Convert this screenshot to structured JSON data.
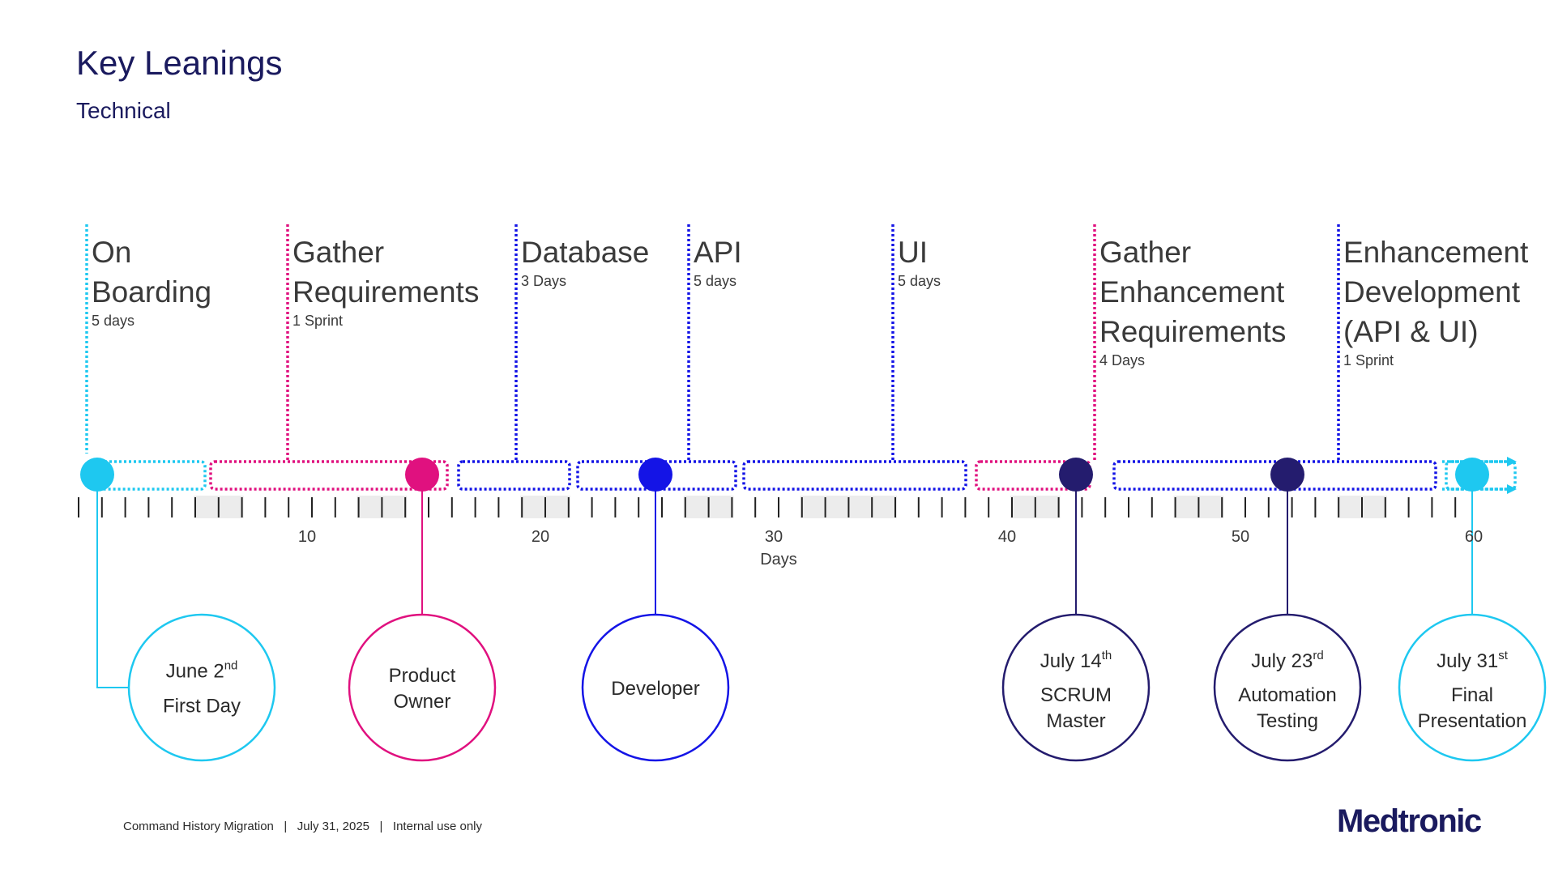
{
  "title": "Key Leanings",
  "subtitle": "Technical",
  "axis": {
    "label": "Days",
    "tick_labels": [
      "10",
      "20",
      "30",
      "40",
      "50",
      "60"
    ]
  },
  "colors": {
    "cyan": "#1ec8f0",
    "magenta": "#e0117f",
    "blue": "#1414e6",
    "navy": "#241c6e",
    "dark_navy": "#2a2072"
  },
  "phases": [
    {
      "title_lines": [
        "On",
        "Boarding"
      ],
      "duration": "5 days",
      "color": "#1ec8f0"
    },
    {
      "title_lines": [
        "Gather",
        "Requirements"
      ],
      "duration": "1 Sprint",
      "color": "#e0117f"
    },
    {
      "title_lines": [
        "Database"
      ],
      "duration": "3 Days",
      "color": "#1414e6"
    },
    {
      "title_lines": [
        "API"
      ],
      "duration": "5 days",
      "color": "#1414e6"
    },
    {
      "title_lines": [
        "UI"
      ],
      "duration": "5 days",
      "color": "#1414e6"
    },
    {
      "title_lines": [
        "Gather",
        "Enhancement",
        "Requirements"
      ],
      "duration": "4 Days",
      "color": "#e0117f"
    },
    {
      "title_lines": [
        "Enhancement",
        "Development",
        "(API & UI)"
      ],
      "duration": "1 Sprint",
      "color": "#1414e6"
    }
  ],
  "milestones": [
    {
      "lines": [
        "June 2|nd",
        "First Day"
      ],
      "color": "#1ec8f0"
    },
    {
      "lines": [
        "Product",
        "Owner"
      ],
      "color": "#e0117f"
    },
    {
      "lines": [
        "Developer"
      ],
      "color": "#1414e6"
    },
    {
      "lines": [
        "July 14|th",
        "SCRUM",
        "Master"
      ],
      "color": "#241c6e"
    },
    {
      "lines": [
        "July 23|rd",
        "Automation",
        "Testing"
      ],
      "color": "#241c6e"
    },
    {
      "lines": [
        "July 31|st",
        "Final",
        "Presentation"
      ],
      "color": "#1ec8f0"
    }
  ],
  "footer": "Command History Migration   |   July 31, 2025   |   Internal use only",
  "logo": "Medtronic"
}
